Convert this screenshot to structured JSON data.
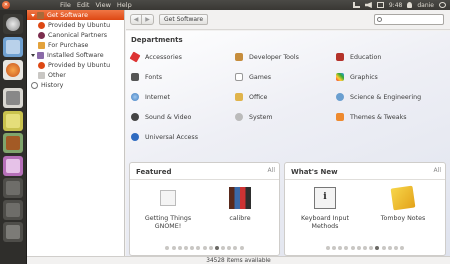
{
  "topbar": {
    "menu": [
      "File",
      "Edit",
      "View",
      "Help"
    ],
    "time": "9:48",
    "user": "danie"
  },
  "sidebar": {
    "items": [
      {
        "label": "Get Software",
        "selected": true
      },
      {
        "label": "Provided by Ubuntu"
      },
      {
        "label": "Canonical Partners"
      },
      {
        "label": "For Purchase"
      },
      {
        "label": "Installed Software"
      },
      {
        "label": "Provided by Ubuntu"
      },
      {
        "label": "Other"
      },
      {
        "label": "History"
      }
    ]
  },
  "toolbar": {
    "back_glyph": "◀",
    "forward_glyph": "▶",
    "breadcrumb": "Get Software",
    "search_placeholder": ""
  },
  "departments": {
    "title": "Departments",
    "items": [
      {
        "label": "Accessories",
        "icon": "accessories-icon"
      },
      {
        "label": "Developer Tools",
        "icon": "developer-tools-icon"
      },
      {
        "label": "Education",
        "icon": "education-icon"
      },
      {
        "label": "Fonts",
        "icon": "fonts-icon"
      },
      {
        "label": "Games",
        "icon": "games-icon"
      },
      {
        "label": "Graphics",
        "icon": "graphics-icon"
      },
      {
        "label": "Internet",
        "icon": "internet-icon"
      },
      {
        "label": "Office",
        "icon": "office-icon"
      },
      {
        "label": "Science & Engineering",
        "icon": "science-icon"
      },
      {
        "label": "Sound & Video",
        "icon": "sound-video-icon"
      },
      {
        "label": "System",
        "icon": "system-icon"
      },
      {
        "label": "Themes & Tweaks",
        "icon": "themes-icon"
      },
      {
        "label": "Universal Access",
        "icon": "universal-access-icon"
      }
    ]
  },
  "featured": {
    "title": "Featured",
    "all": "All",
    "apps": [
      {
        "label": "Getting Things GNOME!"
      },
      {
        "label": "calibre"
      }
    ],
    "dots": 13,
    "active_dot": 8
  },
  "whats_new": {
    "title": "What's New",
    "all": "All",
    "apps": [
      {
        "label": "Keyboard Input Methods"
      },
      {
        "label": "Tomboy Notes"
      }
    ],
    "dots": 13,
    "active_dot": 8
  },
  "status": "34528 items available",
  "colors": {
    "accent": "#dd4814",
    "panel_bg": "#3c3b37"
  }
}
